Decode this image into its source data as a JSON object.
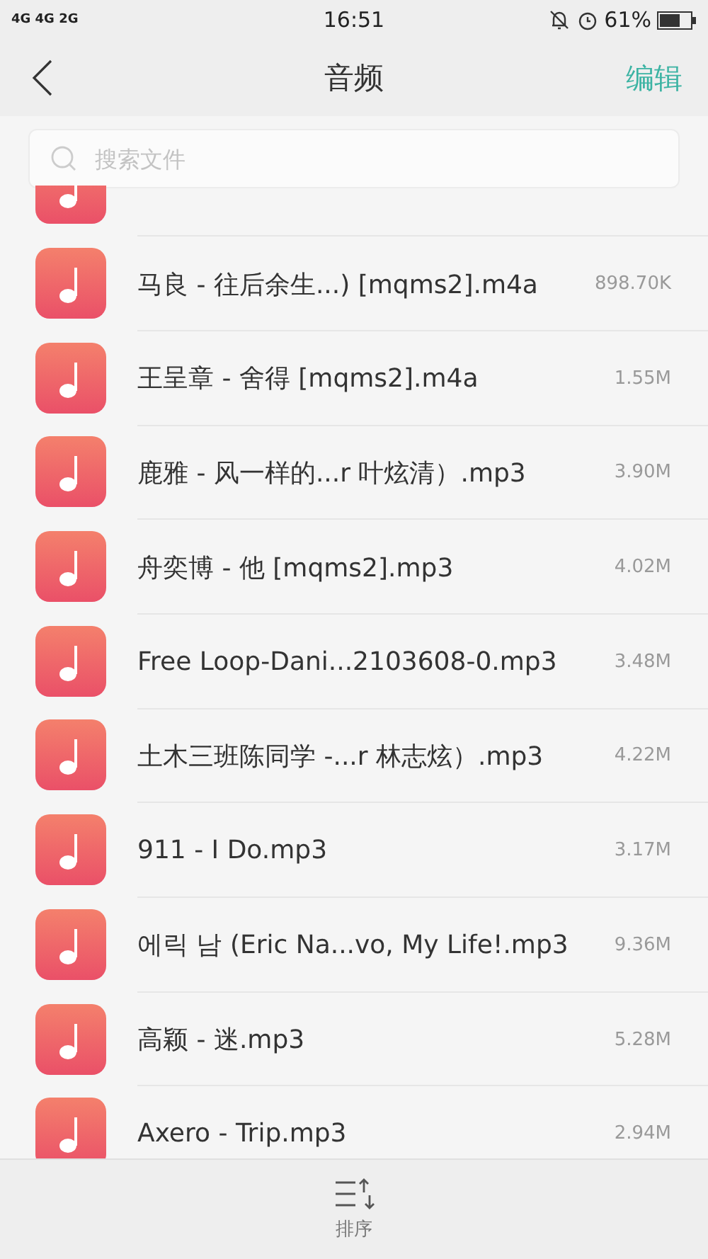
{
  "status_bar": {
    "network": "4G 4G 2G",
    "time": "16:51",
    "battery": "61%"
  },
  "header": {
    "title": "音频",
    "action": "编辑"
  },
  "search": {
    "placeholder": "搜索文件"
  },
  "files": [
    {
      "name": "马良 - 往后余生...) [mqms2].m4a",
      "size": "898.70K"
    },
    {
      "name": "王呈章 - 舍得 [mqms2].m4a",
      "size": "1.55M"
    },
    {
      "name": "鹿雅 - 风一样的...r 叶炫清）.mp3",
      "size": "3.90M"
    },
    {
      "name": "舟奕博 - 他 [mqms2].mp3",
      "size": "4.02M"
    },
    {
      "name": "Free Loop-Dani...2103608-0.mp3",
      "size": "3.48M"
    },
    {
      "name": "土木三班陈同学 -...r 林志炫）.mp3",
      "size": "4.22M"
    },
    {
      "name": "911 - I Do.mp3",
      "size": "3.17M"
    },
    {
      "name": "에릭 남 (Eric Na...vo, My Life!.mp3",
      "size": "9.36M"
    },
    {
      "name": "高颖 - 迷.mp3",
      "size": "5.28M"
    },
    {
      "name": "Axero - Trip.mp3",
      "size": "2.94M"
    }
  ],
  "bottom_bar": {
    "sort_label": "排序"
  }
}
